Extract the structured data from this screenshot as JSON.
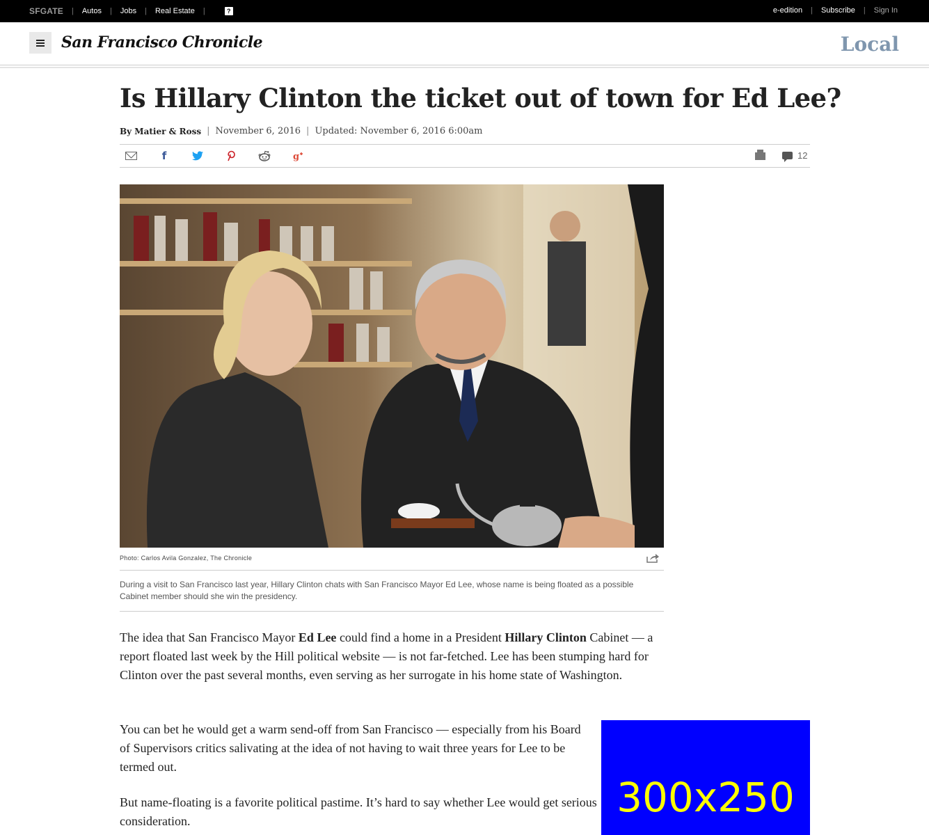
{
  "topbar": {
    "brand": "SFGATE",
    "links": [
      "Autos",
      "Jobs",
      "Real Estate"
    ],
    "help": "?",
    "eedition": "e-edition",
    "subscribe": "Subscribe",
    "signin": "Sign In"
  },
  "masthead": {
    "logo": "San Francisco Chronicle",
    "section": "Local"
  },
  "article": {
    "headline": "Is Hillary Clinton the ticket out of town for Ed Lee?",
    "byline": "By Matier & Ross",
    "date": "November 6, 2016",
    "updated": "Updated: November 6, 2016 6:00am",
    "comment_count": "12",
    "photo_credit": "Photo: Carlos Avila Gonzalez, The Chronicle",
    "caption": "During a visit to San Francisco last year, Hillary Clinton chats with San Francisco Mayor Ed Lee, whose name is being floated as a possible Cabinet member should she win the presidency.",
    "p1": {
      "a": "The idea that San Francisco Mayor ",
      "b": "Ed Lee",
      "c": " could find a home in a President ",
      "d": "Hillary Clinton",
      "e": " Cabinet — a report floated last week by the Hill political website — is not far-fetched. Lee has been stumping hard for Clinton over the past several months, even serving as her surrogate in his home state of Washington."
    },
    "p2": "You can bet he would get a warm send-off from San Francisco — especially from his Board of Supervisors critics salivating at the idea of not having to wait three years for Lee to be termed out.",
    "p3": "But name-floating is a favorite political pastime. It’s hard to say whether Lee would get serious consideration."
  },
  "share_icons": [
    "mail-icon",
    "facebook-icon",
    "twitter-icon",
    "pinterest-icon",
    "reddit-icon",
    "google-plus-icon",
    "print-icon",
    "comment-icon"
  ],
  "ad": {
    "label": "300x250",
    "bg": "#0000ff",
    "fg": "#ffff00"
  },
  "colors": {
    "section": "#7f96ae",
    "facebook": "#3b5998",
    "twitter": "#1da1f2",
    "pinterest": "#cb2027",
    "gplus": "#dd4b39"
  }
}
